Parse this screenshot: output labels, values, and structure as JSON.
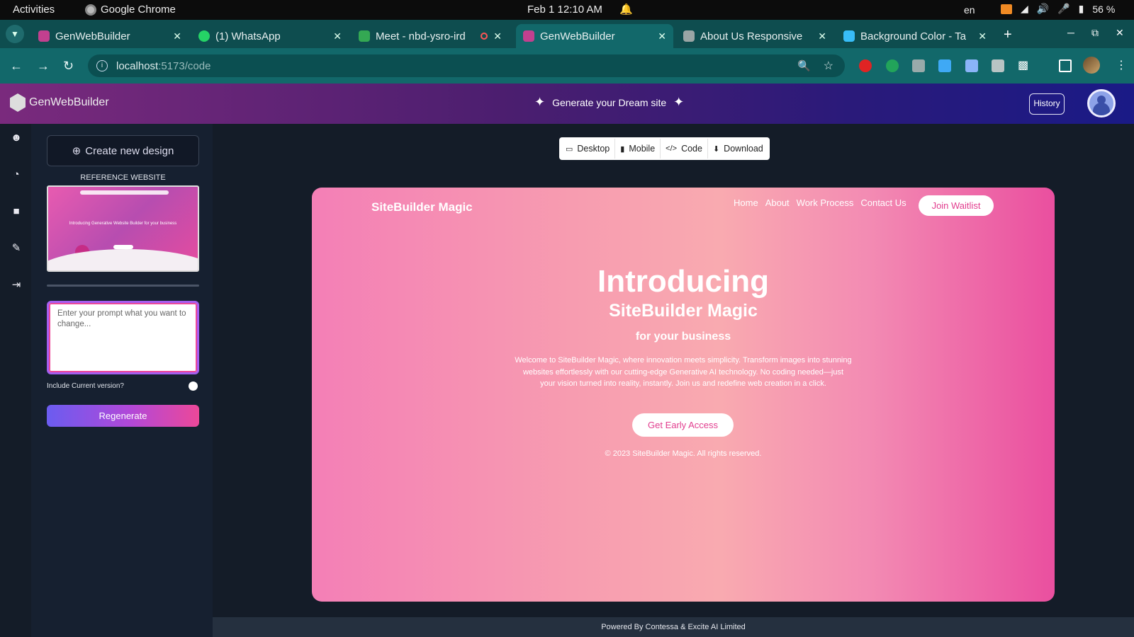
{
  "os": {
    "activities": "Activities",
    "app": "Google Chrome",
    "datetime": "Feb 1  12:10 AM",
    "lang": "en",
    "battery": "56 %"
  },
  "tabs": [
    {
      "title": "GenWebBuilder",
      "color": "#c2408f",
      "active": false
    },
    {
      "title": "(1) WhatsApp",
      "color": "#25d366",
      "active": false
    },
    {
      "title": "Meet - nbd-ysro-ird",
      "color": "#34a853",
      "active": false
    },
    {
      "title": "GenWebBuilder",
      "color": "#c2408f",
      "active": true
    },
    {
      "title": "About Us Responsive",
      "color": "#9aa5a5",
      "active": false
    },
    {
      "title": "Background Color - Ta",
      "color": "#38bdf8",
      "active": false
    }
  ],
  "address": {
    "host": "localhost",
    "path": ":5173/code"
  },
  "header": {
    "app_name": "GenWebBuilder",
    "tagline": "Generate your Dream site",
    "history_label": "History"
  },
  "panel": {
    "create_label": "Create new design",
    "reference_label": "REFERENCE WEBSITE",
    "thumb_text": "Introducing Generative Website Builder for your business",
    "prompt_placeholder": "Enter your prompt what you want to change...",
    "include_label": "Include Current version?",
    "regenerate_label": "Regenerate"
  },
  "view_tabs": {
    "desktop": "Desktop",
    "mobile": "Mobile",
    "code": "Code",
    "download": "Download"
  },
  "preview": {
    "brand": "SiteBuilder Magic",
    "nav": [
      "Home",
      "About",
      "Work Process",
      "Contact Us"
    ],
    "join_label": "Join Waitlist",
    "heading": "Introducing",
    "subheading": "SiteBuilder Magic",
    "tagline": "for your business",
    "description": "Welcome to SiteBuilder Magic, where innovation meets simplicity. Transform images into stunning websites effortlessly with our cutting-edge Generative AI technology. No coding needed—just your vision turned into reality, instantly. Join us and redefine web creation in a click.",
    "cta_label": "Get Early Access",
    "copyright": "© 2023 SiteBuilder Magic. All rights reserved."
  },
  "footer": {
    "text": "Powered By Contessa & Excite AI Limited"
  },
  "colors": {
    "accent_pink": "#ec4899",
    "accent_purple": "#6b5cf0",
    "chrome_teal": "#12686a"
  }
}
